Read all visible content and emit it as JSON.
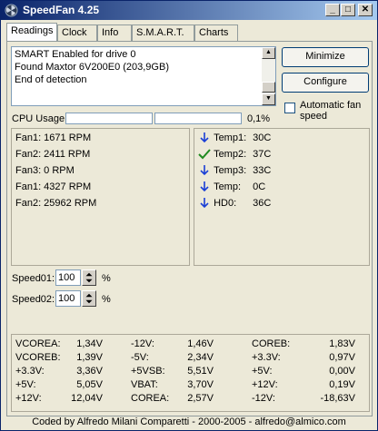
{
  "window": {
    "title": "SpeedFan 4.25"
  },
  "title_buttons": {
    "minimize": "_",
    "maximize": "□",
    "close": "✕"
  },
  "tabs": [
    {
      "label": "Readings",
      "active": true
    },
    {
      "label": "Clock"
    },
    {
      "label": "Info"
    },
    {
      "label": "S.M.A.R.T."
    },
    {
      "label": "Charts"
    }
  ],
  "log": [
    "SMART Enabled for drive 0",
    "Found Maxtor 6V200E0 (203,9GB)",
    "End of detection"
  ],
  "buttons": {
    "minimize": "Minimize",
    "configure": "Configure"
  },
  "auto_fan": {
    "label": "Automatic fan speed",
    "checked": false
  },
  "cpu": {
    "label": "CPU Usage",
    "value": "0,1%",
    "usage_fraction": 0.001
  },
  "fans": [
    "Fan1: 1671 RPM",
    "Fan2: 2411 RPM",
    "Fan3: 0 RPM",
    "Fan1: 4327 RPM",
    "Fan2: 25962 RPM"
  ],
  "temps": [
    {
      "name": "Temp1:",
      "value": "30C",
      "icon": "arrow-down-icon"
    },
    {
      "name": "Temp2:",
      "value": "37C",
      "icon": "checkmark-icon"
    },
    {
      "name": "Temp3:",
      "value": "33C",
      "icon": "arrow-down-icon"
    },
    {
      "name": "Temp:",
      "value": "0C",
      "icon": "arrow-down-icon"
    },
    {
      "name": "HD0:",
      "value": "36C",
      "icon": "arrow-down-icon"
    }
  ],
  "speeds": [
    {
      "label": "Speed01:",
      "value": "100",
      "unit": "%"
    },
    {
      "label": "Speed02:",
      "value": "100",
      "unit": "%"
    }
  ],
  "voltages": [
    [
      {
        "name": "VCOREA:",
        "value": "1,34V"
      },
      {
        "name": "VCOREB:",
        "value": "1,39V"
      },
      {
        "name": "+3.3V:",
        "value": "3,36V"
      },
      {
        "name": "+5V:",
        "value": "5,05V"
      },
      {
        "name": "+12V:",
        "value": "12,04V"
      }
    ],
    [
      {
        "name": "-12V:",
        "value": "1,46V"
      },
      {
        "name": "-5V:",
        "value": "2,34V"
      },
      {
        "name": "+5VSB:",
        "value": "5,51V"
      },
      {
        "name": "VBAT:",
        "value": "3,70V"
      },
      {
        "name": "COREA:",
        "value": "2,57V"
      }
    ],
    [
      {
        "name": "COREB:",
        "value": "1,83V"
      },
      {
        "name": "+3.3V:",
        "value": "0,97V"
      },
      {
        "name": "+5V:",
        "value": "0,00V"
      },
      {
        "name": "+12V:",
        "value": "0,19V"
      },
      {
        "name": "-12V:",
        "value": "-18,63V"
      }
    ]
  ],
  "footer": "Coded by Alfredo Milani Comparetti - 2000-2005 - alfredo@almico.com",
  "colors": {
    "arrow": "#1a3fd6",
    "check": "#1f8a1f",
    "titlebar": "#0a246a"
  }
}
